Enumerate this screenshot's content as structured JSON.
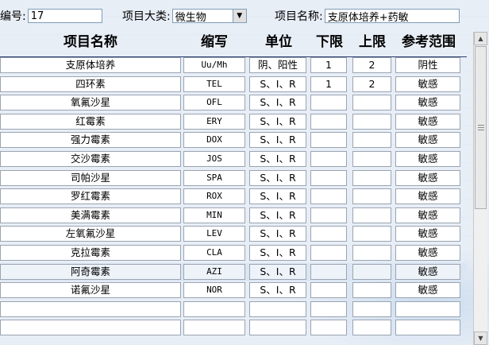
{
  "header": {
    "code_label": "编号:",
    "code_value": "17",
    "category_label": "项目大类:",
    "category_value": "微生物",
    "name_label": "项目名称:",
    "name_value": "支原体培养+药敏"
  },
  "table": {
    "columns": [
      "项目名称",
      "缩写",
      "单位",
      "下限",
      "上限",
      "参考范围"
    ],
    "rows": [
      {
        "name": "支原体培养",
        "abbr": "Uu/Mh",
        "unit": "阴、阳性",
        "low": "1",
        "high": "2",
        "ref": "阴性"
      },
      {
        "name": "四环素",
        "abbr": "TEL",
        "unit": "S、I、R",
        "low": "1",
        "high": "2",
        "ref": "敏感"
      },
      {
        "name": "氧氟沙星",
        "abbr": "OFL",
        "unit": "S、I、R",
        "low": "",
        "high": "",
        "ref": "敏感"
      },
      {
        "name": "红霉素",
        "abbr": "ERY",
        "unit": "S、I、R",
        "low": "",
        "high": "",
        "ref": "敏感"
      },
      {
        "name": "强力霉素",
        "abbr": "DOX",
        "unit": "S、I、R",
        "low": "",
        "high": "",
        "ref": "敏感"
      },
      {
        "name": "交沙霉素",
        "abbr": "JOS",
        "unit": "S、I、R",
        "low": "",
        "high": "",
        "ref": "敏感"
      },
      {
        "name": "司帕沙星",
        "abbr": "SPA",
        "unit": "S、I、R",
        "low": "",
        "high": "",
        "ref": "敏感"
      },
      {
        "name": "罗红霉素",
        "abbr": "ROX",
        "unit": "S、I、R",
        "low": "",
        "high": "",
        "ref": "敏感"
      },
      {
        "name": "美满霉素",
        "abbr": "MIN",
        "unit": "S、I、R",
        "low": "",
        "high": "",
        "ref": "敏感"
      },
      {
        "name": "左氧氟沙星",
        "abbr": "LEV",
        "unit": "S、I、R",
        "low": "",
        "high": "",
        "ref": "敏感"
      },
      {
        "name": "克拉霉素",
        "abbr": "CLA",
        "unit": "S、I、R",
        "low": "",
        "high": "",
        "ref": "敏感"
      },
      {
        "name": "阿奇霉素",
        "abbr": "AZI",
        "unit": "S、I、R",
        "low": "",
        "high": "",
        "ref": "敏感"
      },
      {
        "name": "诺氟沙星",
        "abbr": "NOR",
        "unit": "S、I、R",
        "low": "",
        "high": "",
        "ref": "敏感"
      },
      {
        "name": "",
        "abbr": "",
        "unit": "",
        "low": "",
        "high": "",
        "ref": ""
      },
      {
        "name": "",
        "abbr": "",
        "unit": "",
        "low": "",
        "high": "",
        "ref": ""
      }
    ]
  },
  "icons": {
    "dropdown": "chevron-down-icon",
    "scroll_up": "arrow-up-icon",
    "scroll_down": "arrow-down-icon"
  }
}
